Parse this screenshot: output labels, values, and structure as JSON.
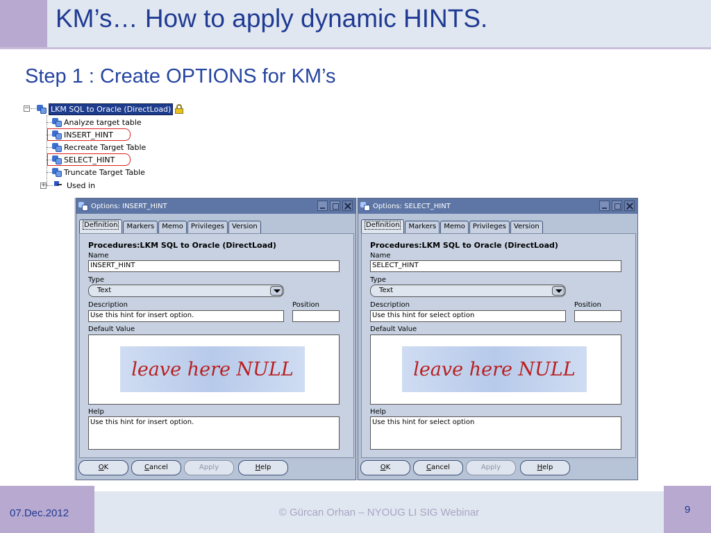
{
  "slide": {
    "title": "KM’s… How to apply dynamic HINTS.",
    "subtitle": "Step 1 : Create OPTIONS for KM’s",
    "footer_date": "07.Dec.2012",
    "footer_text": "© Gürcan Orhan – NYOUG LI SIG Webinar",
    "page_number": "9"
  },
  "tree": {
    "root": "LKM SQL to Oracle (DirectLoad)",
    "children": [
      "Analyze target table",
      "INSERT_HINT",
      "Recreate Target Table",
      "SELECT_HINT",
      "Truncate Target Table"
    ],
    "used_in": "Used in",
    "expand_symbol": "−",
    "collapsed_symbol": "+"
  },
  "dialogs": [
    {
      "title": "Options: INSERT_HINT",
      "tabs": [
        "Definition",
        "Markers",
        "Memo",
        "Privileges",
        "Version"
      ],
      "heading": "Procedures:LKM SQL to Oracle (DirectLoad)",
      "name_label": "Name",
      "name_value": "INSERT_HINT",
      "type_label": "Type",
      "type_value": "Text",
      "description_label": "Description",
      "description_value": "Use this hint for insert option.",
      "position_label": "Position",
      "position_value": "",
      "default_label": "Default Value",
      "null_note": "leave here NULL",
      "help_label": "Help",
      "help_value": "Use this hint for insert option.",
      "buttons": {
        "ok_mnemonic": "O",
        "ok_rest": "K",
        "cancel_mnemonic": "C",
        "cancel_rest": "ancel",
        "apply": "Apply",
        "help_mnemonic": "H",
        "help_rest": "elp"
      }
    },
    {
      "title": "Options: SELECT_HINT",
      "tabs": [
        "Definition",
        "Markers",
        "Memo",
        "Privileges",
        "Version"
      ],
      "heading": "Procedures:LKM SQL to Oracle (DirectLoad)",
      "name_label": "Name",
      "name_value": "SELECT_HINT",
      "type_label": "Type",
      "type_value": "Text",
      "description_label": "Description",
      "description_value": "Use this hint for select option",
      "position_label": "Position",
      "position_value": "",
      "default_label": "Default Value",
      "null_note": "leave here NULL",
      "help_label": "Help",
      "help_value": "Use this hint for select option",
      "buttons": {
        "ok_mnemonic": "O",
        "ok_rest": "K",
        "cancel_mnemonic": "C",
        "cancel_rest": "ancel",
        "apply": "Apply",
        "help_mnemonic": "H",
        "help_rest": "elp"
      }
    }
  ],
  "colors": {
    "title": "#1f3a93",
    "accent": "#b7a9cf",
    "band": "#e1e7f0",
    "dialog_titlebar": "#5e76a5",
    "highlight": "#e02020",
    "null_note_text": "#b82020"
  },
  "icons": {
    "tree_node": "procedure-option-icon",
    "lock": "lock-icon",
    "used_in": "used-in-icon",
    "dialog_title": "option-icon",
    "dropdown": "chevron-down-icon"
  }
}
